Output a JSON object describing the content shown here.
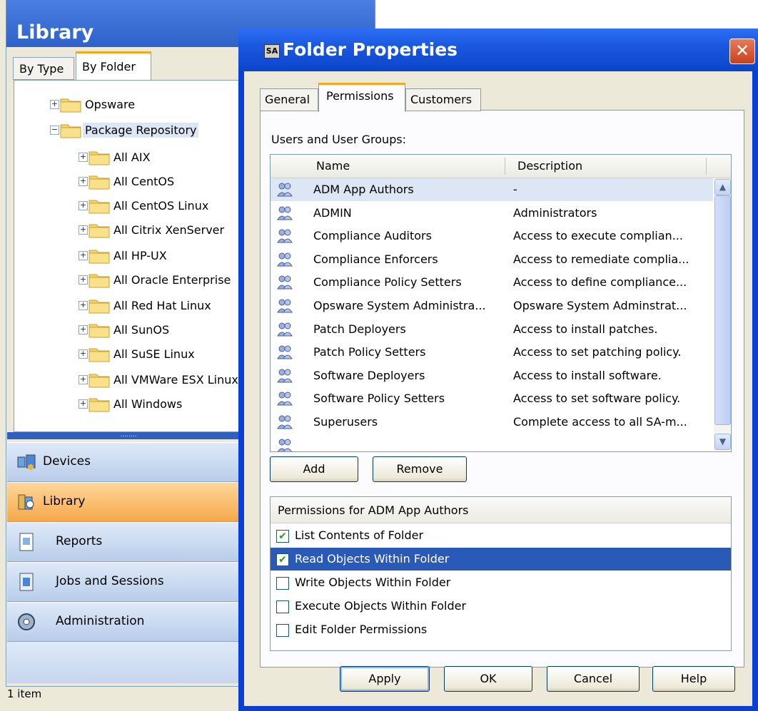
{
  "library": {
    "title": "Library",
    "tabs": [
      {
        "label": "By Type"
      },
      {
        "label": "By Folder"
      }
    ],
    "tree": [
      {
        "label": "Opsware",
        "expander": "+"
      },
      {
        "label": "Package Repository",
        "expander": "−"
      },
      {
        "label": "All AIX",
        "expander": "+"
      },
      {
        "label": "All CentOS",
        "expander": "+"
      },
      {
        "label": "All CentOS Linux",
        "expander": "+"
      },
      {
        "label": "All Citrix XenServer",
        "expander": "+"
      },
      {
        "label": "All HP-UX",
        "expander": "+"
      },
      {
        "label": "All Oracle Enterprise",
        "expander": "+"
      },
      {
        "label": "All Red Hat Linux",
        "expander": "+"
      },
      {
        "label": "All SunOS",
        "expander": "+"
      },
      {
        "label": "All SuSE Linux",
        "expander": "+"
      },
      {
        "label": "All VMWare ESX Linux",
        "expander": "+"
      },
      {
        "label": "All Windows",
        "expander": "+"
      }
    ],
    "splitter_grip": "........",
    "nav": [
      {
        "label": "Devices",
        "icon": "devices-icon"
      },
      {
        "label": "Library",
        "icon": "library-icon"
      },
      {
        "label": "Reports",
        "icon": "reports-icon"
      },
      {
        "label": "Jobs and Sessions",
        "icon": "jobs-icon"
      },
      {
        "label": "Administration",
        "icon": "administration-icon"
      }
    ],
    "status": "1 item"
  },
  "dialog": {
    "title": "Folder Properties",
    "title_icon": "SA",
    "close_glyph": "✕",
    "tabs": [
      {
        "label": "General"
      },
      {
        "label": "Permissions"
      },
      {
        "label": "Customers"
      }
    ],
    "users_label": "Users and User Groups:",
    "columns": {
      "name": "Name",
      "description": "Description"
    },
    "rows": [
      {
        "name": "ADM App Authors",
        "description": "-"
      },
      {
        "name": "ADMIN",
        "description": "Administrators"
      },
      {
        "name": "Compliance Auditors",
        "description": "Access to execute complian..."
      },
      {
        "name": "Compliance Enforcers",
        "description": "Access to remediate complia..."
      },
      {
        "name": "Compliance Policy Setters",
        "description": "Access to define compliance..."
      },
      {
        "name": "Opsware System Administra...",
        "description": "Opsware System Adminstrat..."
      },
      {
        "name": "Patch Deployers",
        "description": "Access to install patches."
      },
      {
        "name": "Patch Policy Setters",
        "description": "Access to set patching policy."
      },
      {
        "name": "Software Deployers",
        "description": "Access to install software."
      },
      {
        "name": "Software Policy Setters",
        "description": "Access to set software policy."
      },
      {
        "name": "Superusers",
        "description": "Complete access to all SA-m..."
      }
    ],
    "scroll_up": "▲",
    "scroll_down": "▼",
    "add_label": "Add",
    "remove_label": "Remove",
    "permissions_header": "Permissions for ADM App Authors",
    "permissions": [
      {
        "label": "List Contents of Folder",
        "checked": true
      },
      {
        "label": "Read Objects Within Folder",
        "checked": true
      },
      {
        "label": "Write Objects Within Folder",
        "checked": false
      },
      {
        "label": "Execute Objects Within Folder",
        "checked": false
      },
      {
        "label": "Edit Folder Permissions",
        "checked": false
      }
    ],
    "check_glyph": "✔",
    "buttons": {
      "apply": "Apply",
      "ok": "OK",
      "cancel": "Cancel",
      "help": "Help"
    }
  }
}
